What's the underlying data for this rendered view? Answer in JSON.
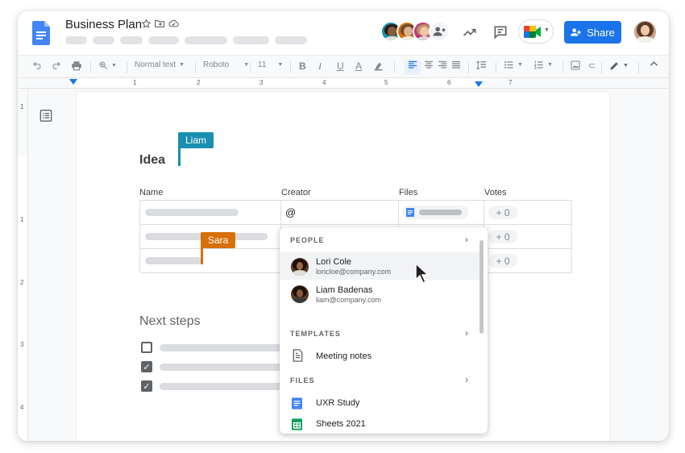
{
  "doc": {
    "title": "Business Plan"
  },
  "header": {
    "share_label": "Share"
  },
  "toolbar": {
    "style_label": "Normal text",
    "font_label": "Roboto",
    "size_label": "11"
  },
  "ruler": {
    "marks": [
      "1",
      "2",
      "3",
      "4",
      "5",
      "6",
      "7"
    ],
    "vmarks": [
      "1",
      "1",
      "2",
      "3",
      "4"
    ]
  },
  "content": {
    "idea_heading": "Idea",
    "columns": [
      "Name",
      "Creator",
      "Files",
      "Votes"
    ],
    "creator_input": "@",
    "votes": [
      "+ 0",
      "+ 0",
      "+ 0"
    ],
    "next_steps_heading": "Next steps",
    "cursors": [
      {
        "name": "Liam",
        "color": "#1a8fb1"
      },
      {
        "name": "Sara",
        "color": "#d5700a"
      }
    ]
  },
  "mention_popup": {
    "people_header": "PEOPLE",
    "people": [
      {
        "name": "Lori Cole",
        "email": "loricloe@company.com"
      },
      {
        "name": "Liam Badenas",
        "email": "liam@company.com"
      }
    ],
    "templates_header": "TEMPLATES",
    "templates": [
      "Meeting notes"
    ],
    "files_header": "FILES",
    "files": [
      "UXR Study",
      "Sheets 2021"
    ]
  },
  "colors": {
    "accent": "#1a73e8",
    "docs_blue": "#4285f4",
    "sheets_green": "#0f9d58"
  }
}
